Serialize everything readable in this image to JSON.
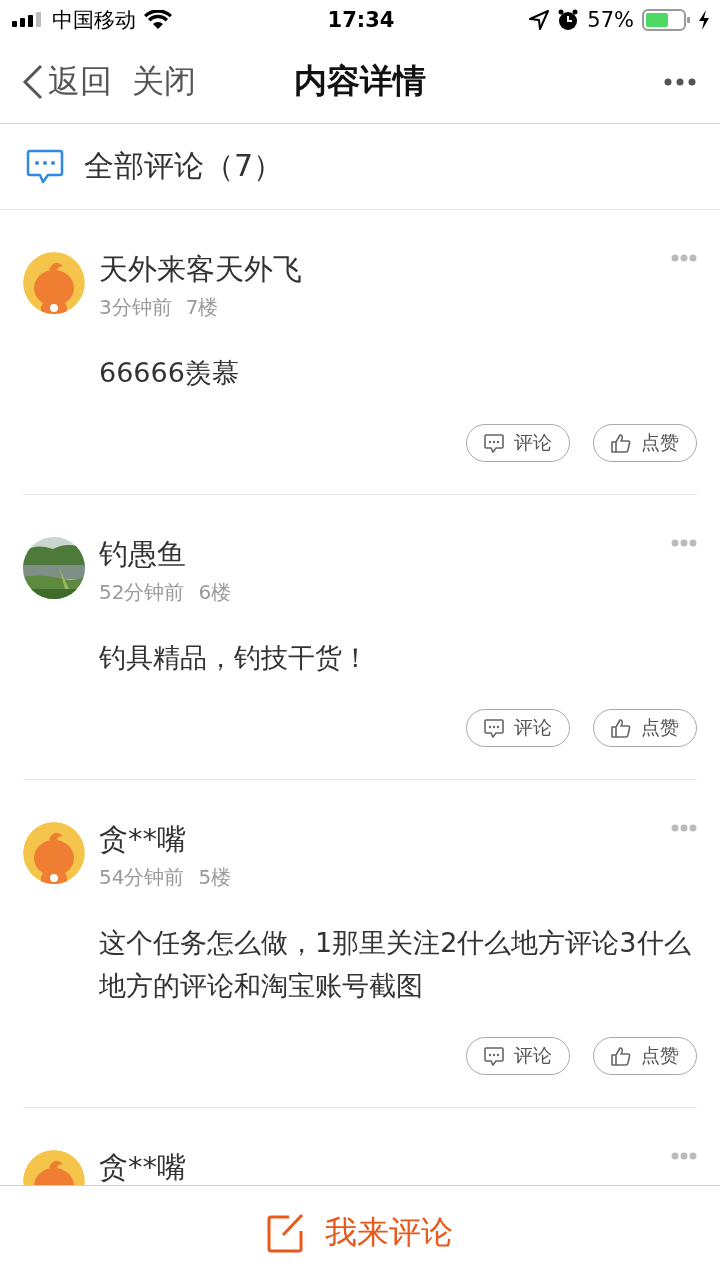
{
  "status_bar": {
    "carrier": "中国移动",
    "time": "17:34",
    "battery": "57%"
  },
  "nav": {
    "back": "返回",
    "close": "关闭",
    "title": "内容详情"
  },
  "section": {
    "title": "全部评论（7）"
  },
  "comments": [
    {
      "avatar": {
        "kind": "mascot"
      },
      "name": "天外来客天外飞",
      "time": "3分钟前",
      "floor": "7楼",
      "text": "66666羡慕",
      "reply": "评论",
      "like": "点赞"
    },
    {
      "name": "钓愚鱼",
      "time": "52分钟前",
      "floor": "6楼",
      "text": "钓具精品，钓技干货！",
      "reply": "评论",
      "like": "点赞"
    },
    {
      "avatar": {
        "kind": "mascot"
      },
      "name": "贪**嘴",
      "time": "54分钟前",
      "floor": "5楼",
      "text": "这个任务怎么做，1那里关注2什么地方评论3什么地方的评论和淘宝账号截图",
      "reply": "评论",
      "like": "点赞"
    },
    {
      "avatar": {
        "kind": "mascot"
      },
      "name": "贪**嘴"
    }
  ],
  "footer": {
    "label": "我来评论"
  }
}
